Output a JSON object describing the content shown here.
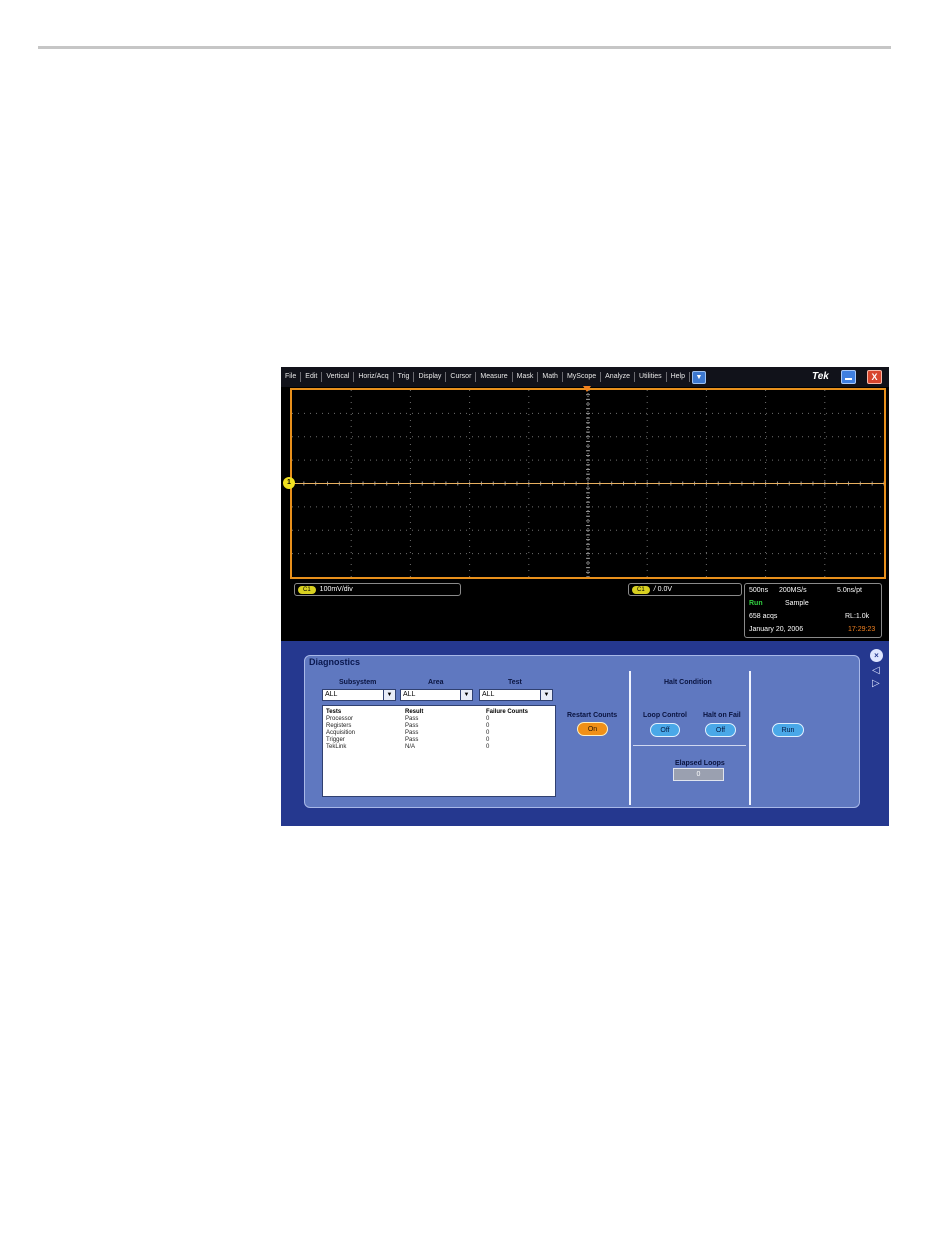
{
  "menu": {
    "items": [
      "File",
      "Edit",
      "Vertical",
      "Horiz/Acq",
      "Trig",
      "Display",
      "Cursor",
      "Measure",
      "Mask",
      "Math",
      "MyScope",
      "Analyze",
      "Utilities",
      "Help"
    ],
    "dropdown_arrow": "▼",
    "brand": "Tek",
    "close_glyph": "X"
  },
  "channel": {
    "badge": "C1",
    "marker": "1",
    "scale": "100mV/div",
    "trigger_level": "0.0V",
    "trigger_slope_glyph": "/"
  },
  "acquisition": {
    "timebase": "500ns",
    "sample_rate": "200MS/s",
    "resolution": "5.0ns/pt",
    "state": "Run",
    "mode": "Sample",
    "acqs": "658 acqs",
    "record_length": "RL:1.0k",
    "date": "January 20, 2006",
    "time": "17:29:23"
  },
  "diagnostics": {
    "title": "Diagnostics",
    "subsystem_label": "Subsystem",
    "subsystem_value": "ALL",
    "area_label": "Area",
    "area_value": "ALL",
    "test_label": "Test",
    "test_value": "ALL",
    "table_headers": [
      "Tests",
      "Result",
      "Failure Counts"
    ],
    "rows": [
      {
        "test": "Processor",
        "result": "Pass",
        "failures": "0"
      },
      {
        "test": "Registers",
        "result": "Pass",
        "failures": "0"
      },
      {
        "test": "Acquisition",
        "result": "Pass",
        "failures": "0"
      },
      {
        "test": "Trigger",
        "result": "Pass",
        "failures": "0"
      },
      {
        "test": "TekLink",
        "result": "N/A",
        "failures": "0"
      }
    ],
    "restart_counts_label": "Restart Counts",
    "restart_counts_value": "On",
    "halt_condition_label": "Halt Condition",
    "loop_control_label": "Loop Control",
    "loop_control_value": "Off",
    "halt_on_fail_label": "Halt on Fail",
    "halt_on_fail_value": "Off",
    "elapsed_loops_label": "Elapsed Loops",
    "elapsed_loops_value": "0",
    "run_label": "Run"
  },
  "colors": {
    "accent_orange": "#e8901c",
    "trace_yellow": "#f0e020",
    "panel_blue": "#5f78c0",
    "run_green": "#30d040",
    "time_orange": "#f08020"
  }
}
